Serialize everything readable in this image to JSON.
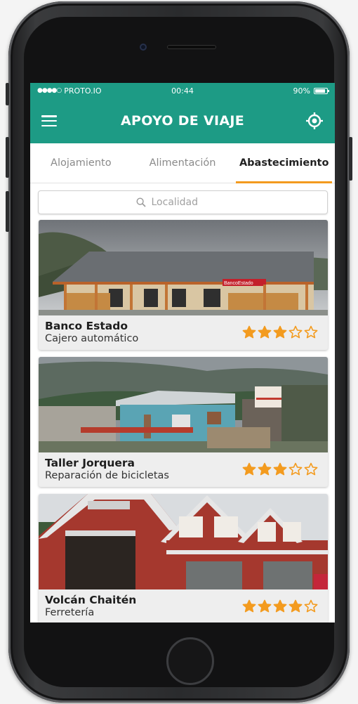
{
  "status_bar": {
    "carrier": "PROTO.IO",
    "time": "00:44",
    "battery": "90%",
    "battery_level": 0.9
  },
  "app_bar": {
    "title": "APOYO DE VIAJE",
    "menu_icon": "hamburger-icon",
    "locate_icon": "locate-target-icon"
  },
  "tabs": [
    {
      "label": "Alojamiento",
      "active": false
    },
    {
      "label": "Alimentación",
      "active": false
    },
    {
      "label": "Abastecimiento",
      "active": true
    }
  ],
  "search": {
    "placeholder": "Localidad",
    "icon": "search-icon"
  },
  "places": [
    {
      "name": "Banco Estado",
      "category": "Cajero automático",
      "rating": 3,
      "max_rating": 5,
      "sign": "BancoEstado"
    },
    {
      "name": "Taller Jorquera",
      "category": "Reparación de bicicletas",
      "rating": 3,
      "max_rating": 5
    },
    {
      "name": "Volcán Chaitén",
      "category": "Ferretería",
      "rating": 4,
      "max_rating": 5
    }
  ],
  "colors": {
    "primary": "#1d9b85",
    "accent": "#f39b1f",
    "star": "#f39b1f"
  }
}
